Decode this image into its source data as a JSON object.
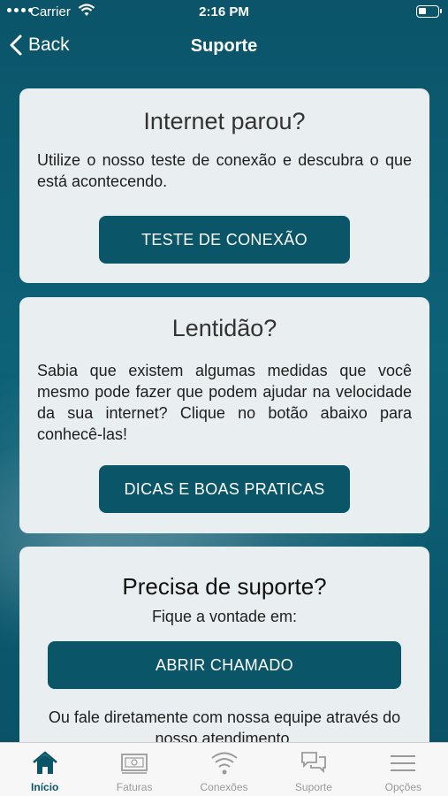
{
  "status_bar": {
    "carrier": "Carrier",
    "time": "2:16 PM"
  },
  "nav": {
    "back_label": "Back",
    "title": "Suporte"
  },
  "cards": {
    "internet": {
      "title": "Internet parou?",
      "body": "Utilize o nosso teste de conexão e descubra o que está acontecendo.",
      "button": "TESTE DE CONEXÃO"
    },
    "lentidao": {
      "title": "Lentidão?",
      "body": "Sabia que existem algumas medidas que você mesmo pode fazer que podem ajudar na velocidade da sua internet? Clique no botão abaixo para conhecê-las!",
      "button": "DICAS E BOAS PRATICAS"
    },
    "suporte": {
      "title": "Precisa de suporte?",
      "subtitle": "Fique a vontade em:",
      "button": "ABRIR CHAMADO",
      "footer": "Ou fale diretamente com nossa equipe através do nosso atendimento."
    }
  },
  "tabs": [
    {
      "label": "Início",
      "icon": "home-icon",
      "active": true
    },
    {
      "label": "Faturas",
      "icon": "bill-icon",
      "active": false
    },
    {
      "label": "Conexões",
      "icon": "wifi-icon",
      "active": false
    },
    {
      "label": "Suporte",
      "icon": "chat-icon",
      "active": false
    },
    {
      "label": "Opções",
      "icon": "menu-icon",
      "active": false
    }
  ],
  "colors": {
    "accent": "#0b5569",
    "card_bg": "#e9eef1",
    "tab_inactive": "#9a9a9a"
  }
}
